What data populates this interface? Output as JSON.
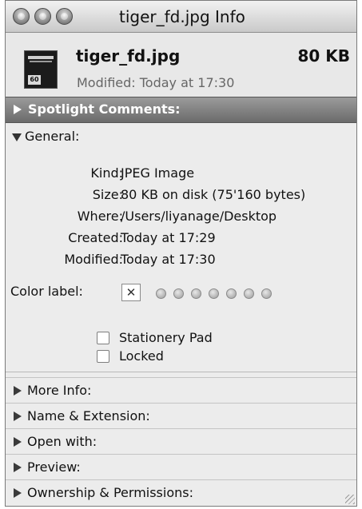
{
  "window": {
    "title": "tiger_fd.jpg Info"
  },
  "file": {
    "name": "tiger_fd.jpg",
    "size": "80 KB",
    "modified": "Modified: Today at 17:30",
    "thumbnail_tag": "60"
  },
  "spotlight": {
    "label": "Spotlight Comments:"
  },
  "general": {
    "label": "General:",
    "rows": [
      {
        "key": "Kind:",
        "value": "JPEG Image"
      },
      {
        "key": "Size:",
        "value": "80 KB on disk (75'160 bytes)"
      },
      {
        "key": "Where:",
        "value": "/Users/liyanage/Desktop"
      },
      {
        "key": "Created:",
        "value": "Today at 17:29"
      },
      {
        "key": "Modified:",
        "value": "Today at 17:30"
      }
    ],
    "color_label": {
      "key": "Color label:",
      "none_symbol": "✕"
    },
    "checkboxes": [
      {
        "label": "Stationery Pad",
        "checked": false
      },
      {
        "label": "Locked",
        "checked": false
      }
    ]
  },
  "sections": [
    {
      "label": "More Info:"
    },
    {
      "label": "Name & Extension:"
    },
    {
      "label": "Open with:"
    },
    {
      "label": "Preview:"
    },
    {
      "label": "Ownership & Permissions:"
    }
  ]
}
